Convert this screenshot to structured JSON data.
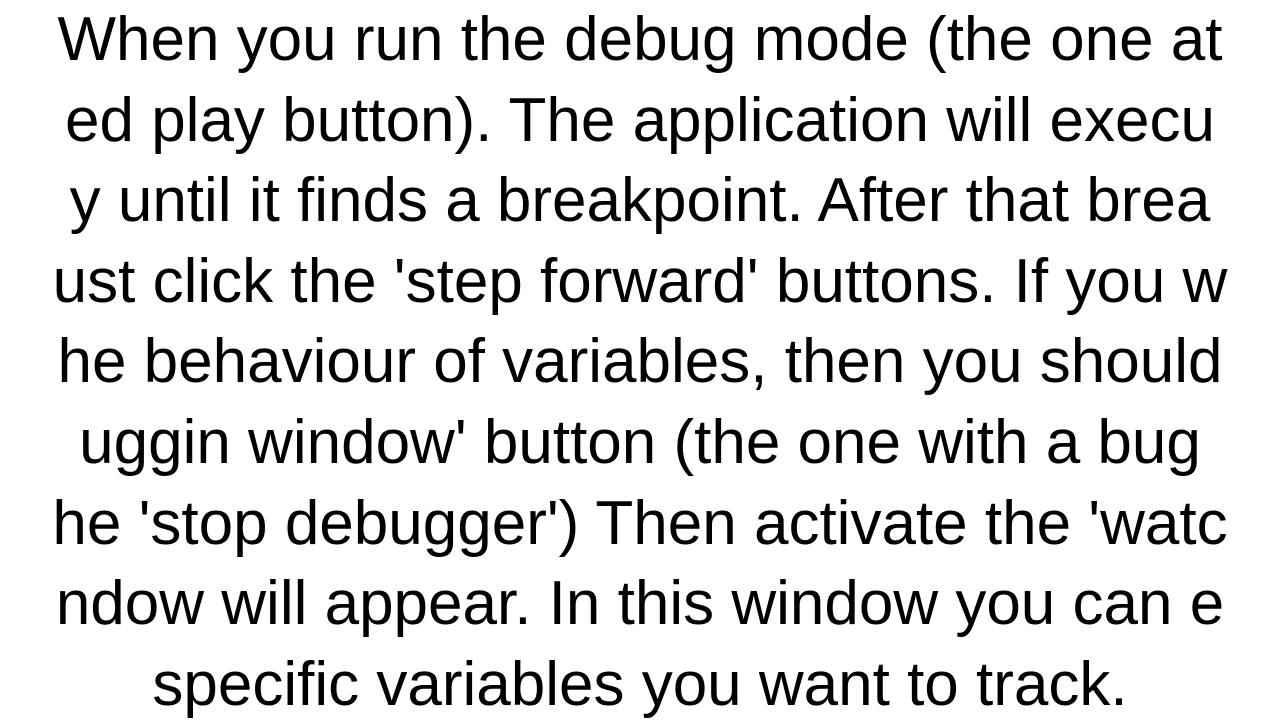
{
  "document": {
    "body_text": "When you run the debug mode (the one at\ned play button). The application will execu\ny until it finds a breakpoint. After that brea\nust click the 'step forward' buttons. If you w\nhe behaviour of variables, then you should\nuggin window' button (the one with a bug\nhe 'stop debugger') Then activate the 'watc\nndow will appear. In this window you can e\nspecific variables you want to track."
  }
}
